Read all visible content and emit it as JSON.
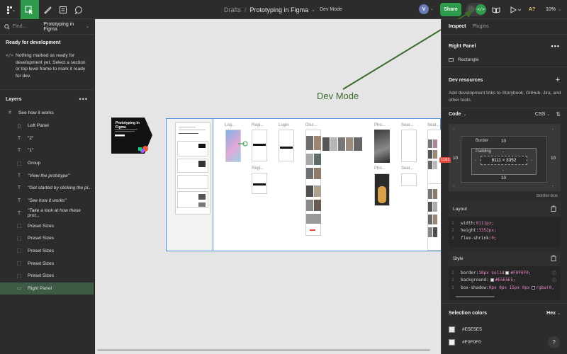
{
  "toolbar": {
    "breadcrumb_parent": "Drafts",
    "breadcrumb_separator": "/",
    "file_name": "Prototyping in Figma",
    "mode_label": "Dev Mode",
    "avatar_letter": "V",
    "share_label": "Share",
    "ai_label": "A?",
    "zoom_label": "10%"
  },
  "left_panel": {
    "search_placeholder": "Find...",
    "page_name": "Prototyping in Figma",
    "ready_title": "Ready for development",
    "ready_message": "Nothing marked as ready for development yet. Select a section or top level frame to mark it ready for dev.",
    "layers_title": "Layers",
    "layers": [
      {
        "label": "See how it works",
        "icon": "hash",
        "level": 0,
        "selected": false
      },
      {
        "label": "Left Panel",
        "icon": "rect",
        "level": 1,
        "selected": false
      },
      {
        "label": "\"2\"",
        "icon": "text",
        "level": 1,
        "selected": false
      },
      {
        "label": "\"1\"",
        "icon": "text",
        "level": 1,
        "selected": false
      },
      {
        "label": "Group",
        "icon": "group",
        "level": 1,
        "selected": false
      },
      {
        "label": "\"View the prototype\"",
        "icon": "text",
        "level": 1,
        "selected": false
      },
      {
        "label": "\"Get started by clicking the pl...",
        "icon": "text",
        "level": 1,
        "selected": false
      },
      {
        "label": "\"See how it works\"",
        "icon": "text",
        "level": 1,
        "selected": false
      },
      {
        "label": "\"Take a look at how these prot...",
        "icon": "text",
        "level": 1,
        "selected": false
      },
      {
        "label": "Preset Sizes",
        "icon": "group",
        "level": 1,
        "selected": false
      },
      {
        "label": "Preset Sizes",
        "icon": "group",
        "level": 1,
        "selected": false
      },
      {
        "label": "Preset Sizes",
        "icon": "group",
        "level": 1,
        "selected": false
      },
      {
        "label": "Preset Sizes",
        "icon": "group",
        "level": 1,
        "selected": false
      },
      {
        "label": "Preset Sizes",
        "icon": "group",
        "level": 1,
        "selected": false
      },
      {
        "label": "Right Panel",
        "icon": "rect-line",
        "level": 1,
        "selected": true
      }
    ]
  },
  "canvas": {
    "annotation": "Dev Mode",
    "promo_title": "Prototyping in Figma",
    "frame_labels": [
      "Log...",
      "Regi...",
      "Login",
      "Disc...",
      "Pho...",
      "Sear...",
      "Sear...",
      "Regi...",
      "Pho...",
      "Sear..."
    ]
  },
  "right_panel": {
    "tabs": [
      {
        "label": "Inspect",
        "active": true
      },
      {
        "label": "Plugins",
        "active": false
      }
    ],
    "selection_title": "Right Panel",
    "selection_type": "Rectangle",
    "dev_resources_title": "Dev resources",
    "dev_resources_desc": "Add development links to Storybook, GitHub, Jira, and other tools.",
    "code_title": "Code",
    "code_lang": "CSS",
    "box_model": {
      "border_label": "Border",
      "border_top": "10",
      "border_bottom": "10",
      "border_left": "10",
      "border_right": "10",
      "padding_label": "Padding",
      "padding_top": "-",
      "padding_bottom": "-",
      "padding_left": "-",
      "padding_right": "-",
      "content_size": "8111 × 3352",
      "offset_badge": "1191",
      "outer_dash": "-",
      "caption": "border-box"
    },
    "layout_block": {
      "title": "Layout",
      "lines": [
        {
          "num": "1",
          "prop": "width: ",
          "val": "8111px;",
          "swatch": "",
          "swatch_color": "",
          "info": false
        },
        {
          "num": "2",
          "prop": "height: ",
          "val": "3352px;",
          "swatch": "",
          "swatch_color": "",
          "info": false
        },
        {
          "num": "3",
          "prop": "flex-shrink: ",
          "val": "0;",
          "swatch": "",
          "swatch_color": "",
          "info": false
        }
      ]
    },
    "style_block": {
      "title": "Style",
      "lines": [
        {
          "num": "1",
          "prop": "border: ",
          "val": "10px solid ",
          "swatch": "#F0F0F0;",
          "swatch_color": "#F0F0F0",
          "info": true
        },
        {
          "num": "2",
          "prop": "background: ",
          "val": "",
          "swatch": "#E5E5E5;",
          "swatch_color": "#E5E5E5",
          "info": true
        },
        {
          "num": "3",
          "prop": "box-shadow: ",
          "val": "0px 0px 15px 0px ",
          "swatch": "rgba(0,",
          "swatch_color": "#000000",
          "info": false
        }
      ]
    },
    "selection_colors_title": "Selection colors",
    "selection_colors_format": "Hex",
    "selection_colors": [
      {
        "hex": "#E5E5E5",
        "label": "#E5E5E5"
      },
      {
        "hex": "#F0F0F0",
        "label": "#F0F0F0"
      }
    ]
  },
  "colors": {
    "accent_green": "#2e9a4c",
    "panel_bg": "#2c2c2c",
    "canvas_bg": "#e5e5e5",
    "selection_blue": "#4a90e2"
  }
}
